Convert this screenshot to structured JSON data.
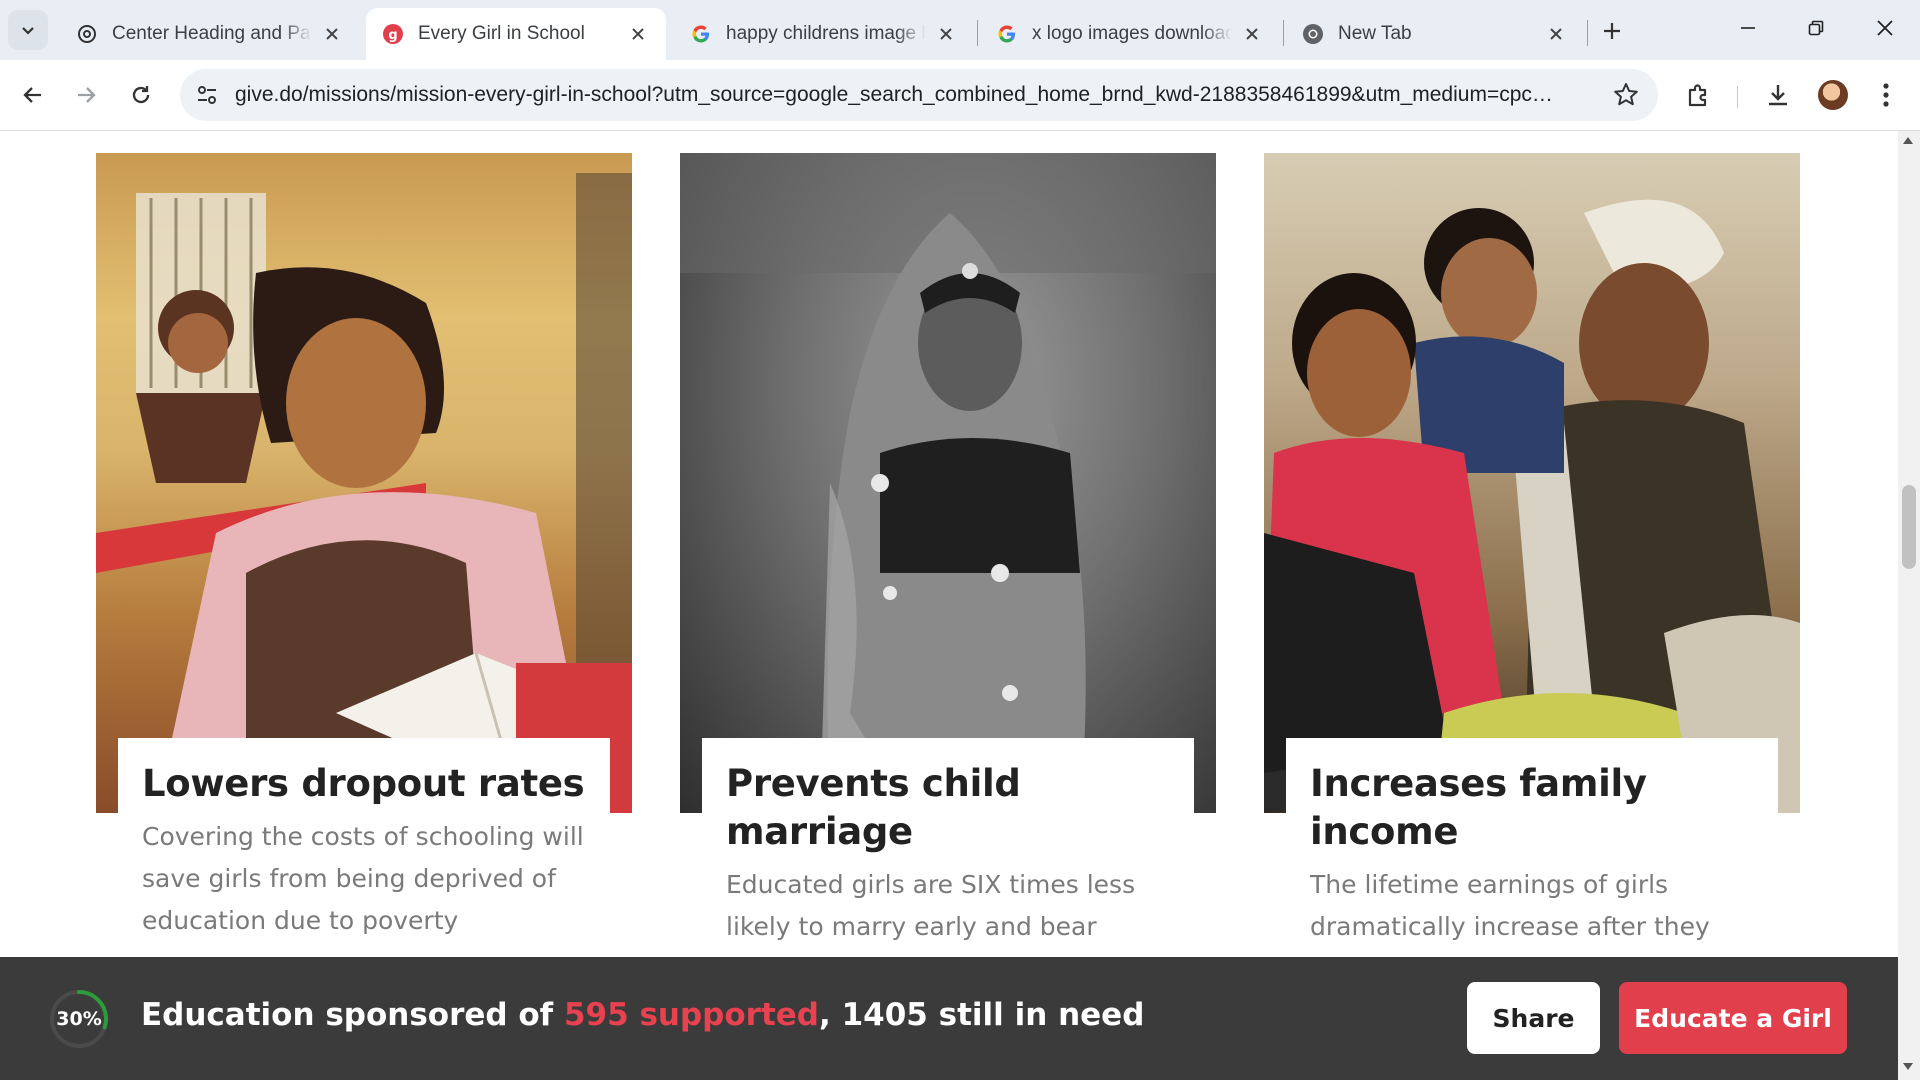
{
  "browser": {
    "tabs": [
      {
        "title": "Center Heading and Para",
        "favicon": "openai-icon",
        "active": false
      },
      {
        "title": "Every Girl in School",
        "favicon": "give-icon",
        "active": true
      },
      {
        "title": "happy childrens image hd",
        "favicon": "google-icon",
        "active": false
      },
      {
        "title": "x logo images download",
        "favicon": "google-icon",
        "active": false
      },
      {
        "title": "New Tab",
        "favicon": "chrome-icon",
        "active": false
      }
    ],
    "url": "give.do/missions/mission-every-girl-in-school?utm_source=google_search_combined_home_brnd_kwd-2188358461899&utm_medium=cpc&ut..."
  },
  "cards": [
    {
      "title": "Lowers dropout rates",
      "text": "Covering the costs of schooling will save girls from being deprived of education due to poverty"
    },
    {
      "title": "Prevents child marriage",
      "text": "Educated girls are SIX times less likely to marry early and bear children before adulthood"
    },
    {
      "title": "Increases family income",
      "text": "The lifetime earnings of girls dramatically increase after they"
    }
  ],
  "bottom_bar": {
    "progress_percent": 30,
    "progress_label": "30%",
    "text_prefix": "Education sponsored of ",
    "supported": "595 supported",
    "text_suffix": ", 1405 still in need",
    "share_label": "Share",
    "educate_label": "Educate a Girl"
  },
  "colors": {
    "accent": "#e23f4d",
    "progress": "#2e9b3a",
    "bar_bg": "#3b3b3b"
  }
}
